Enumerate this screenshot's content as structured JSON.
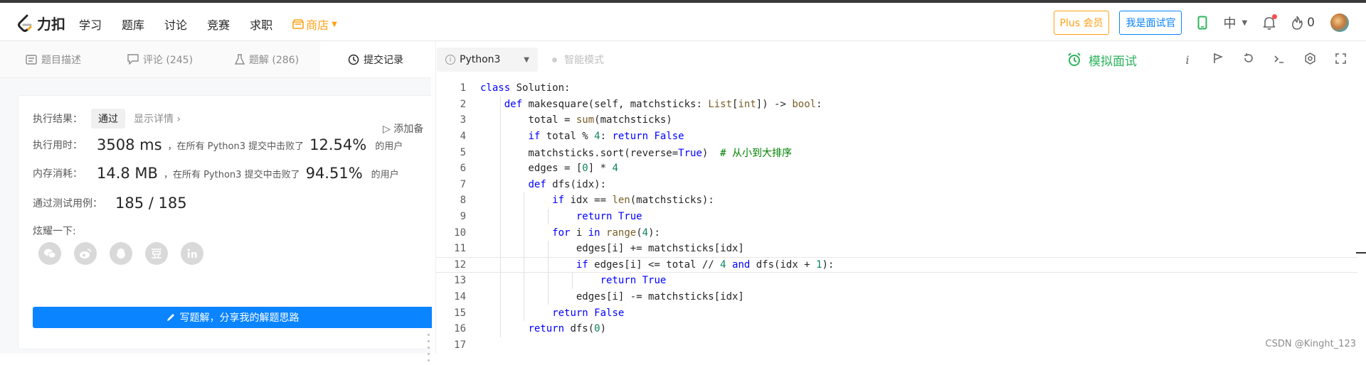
{
  "header": {
    "logo_text": "力扣",
    "nav": [
      "学习",
      "题库",
      "讨论",
      "竞赛",
      "求职"
    ],
    "shop_label": "商店",
    "plus_label": "Plus 会员",
    "interviewer_label": "我是面试官",
    "lang_label": "中",
    "fire_count": "0",
    "colors": {
      "accent_orange": "#ffa116",
      "accent_blue": "#0a84ff"
    }
  },
  "tabs": [
    {
      "label": "题目描述",
      "icon": "description-icon"
    },
    {
      "label": "评论 (245)",
      "icon": "comment-icon"
    },
    {
      "label": "题解 (286)",
      "icon": "flask-icon"
    },
    {
      "label": "提交记录",
      "icon": "clock-icon"
    }
  ],
  "result": {
    "label_result": "执行结果：",
    "status": "通过",
    "detail_link": "显示详情",
    "add_note": "添加备",
    "label_time": "执行用时：",
    "time_value": "3508 ms",
    "time_mid": "，在所有 Python3 提交中击败了",
    "time_percent": "12.54%",
    "time_suffix": "的用户",
    "label_mem": "内存消耗：",
    "mem_value": "14.8 MB",
    "mem_mid": "，在所有 Python3 提交中击败了",
    "mem_percent": "94.51%",
    "mem_suffix": "的用户",
    "label_cases": "通过测试用例：",
    "cases_value": "185 / 185",
    "share_label": "炫耀一下:",
    "share_icons": [
      "wechat-icon",
      "weibo-icon",
      "qq-icon",
      "douban-icon",
      "linkedin-icon"
    ],
    "write_button": "写题解，分享我的解题思路"
  },
  "editor": {
    "language": "Python3",
    "smart_mode": "智能模式",
    "mock_interview": "模拟面试",
    "current_line": 12,
    "colors": {
      "mock_green": "#2db55d"
    },
    "lines": [
      "class Solution:",
      "    def makesquare(self, matchsticks: List[int]) -> bool:",
      "        total = sum(matchsticks)",
      "        if total % 4: return False",
      "        matchsticks.sort(reverse=True)  # 从小到大排序",
      "        edges = [0] * 4",
      "        def dfs(idx):",
      "            if idx == len(matchsticks):",
      "                return True",
      "            for i in range(4):",
      "                edges[i] += matchsticks[idx]",
      "                if edges[i] <= total // 4 and dfs(idx + 1):",
      "                    return True",
      "                edges[i] -= matchsticks[idx]",
      "            return False",
      "        return dfs(0)",
      ""
    ]
  },
  "watermark": "CSDN @Kinght_123"
}
